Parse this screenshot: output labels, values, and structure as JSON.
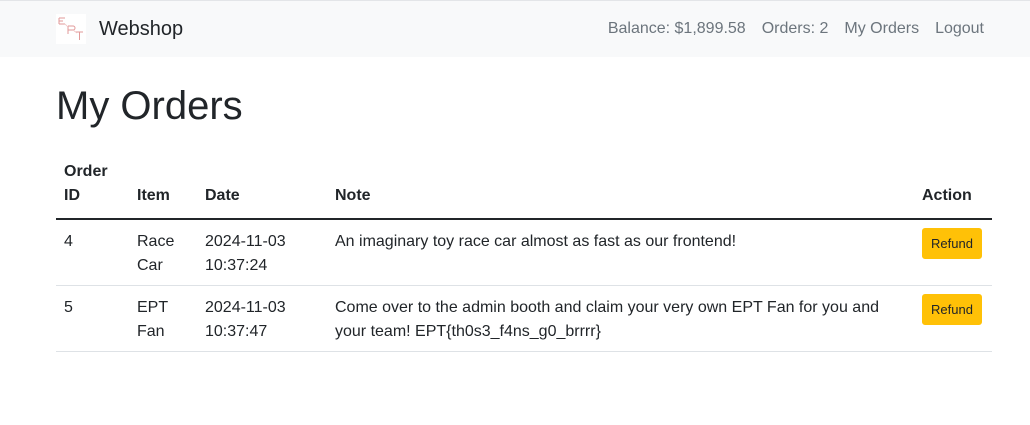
{
  "navbar": {
    "brand": "Webshop",
    "balance": "Balance: $1,899.58",
    "orders_count": "Orders: 2",
    "my_orders": "My Orders",
    "logout": "Logout"
  },
  "page": {
    "title": "My Orders"
  },
  "table": {
    "headers": {
      "order_id_line1": "Order",
      "order_id_line2": "ID",
      "item": "Item",
      "date": "Date",
      "note": "Note",
      "action": "Action"
    },
    "rows": [
      {
        "id": "4",
        "item_line1": "Race",
        "item_line2": "Car",
        "date_line1": "2024-11-03",
        "date_line2": "10:37:24",
        "note": "An imaginary toy race car almost as fast as our frontend!",
        "action": "Refund"
      },
      {
        "id": "5",
        "item_line1": "EPT",
        "item_line2": "Fan",
        "date_line1": "2024-11-03",
        "date_line2": "10:37:47",
        "note": "Come over to the admin booth and claim your very own EPT Fan for you and your team! EPT{th0s3_f4ns_g0_brrrr}",
        "action": "Refund"
      }
    ]
  },
  "colors": {
    "navbar_bg": "#f8f9fa",
    "refund_button": "#ffc107",
    "nav_text": "#6c757d"
  }
}
